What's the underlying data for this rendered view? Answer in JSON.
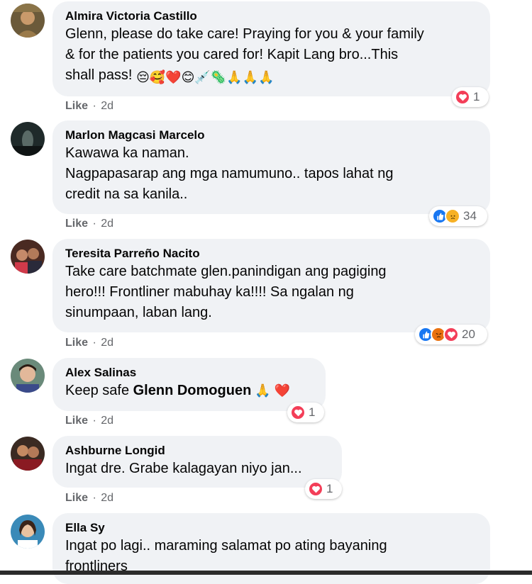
{
  "comments": [
    {
      "author": "Almira Victoria Castillo",
      "lines": [
        "Glenn, please do take care! Praying for you & your family",
        "& for the patients you cared for! Kapit Lang bro...This",
        "shall pass!"
      ],
      "emoji_line": "😔🥰❤️😊💉🦠🙏🙏🙏",
      "like_label": "Like",
      "time": "2d",
      "reaction_count": "1"
    },
    {
      "author": "Marlon Magcasi Marcelo",
      "lines": [
        "Kawawa ka naman.",
        "Nagpapasarap ang mga namumuno.. tapos lahat ng",
        "credit na sa kanila.."
      ],
      "like_label": "Like",
      "time": "2d",
      "reaction_count": "34"
    },
    {
      "author": "Teresita Parreño Nacito",
      "lines": [
        "Take care batchmate glen.panindigan ang pagiging",
        "hero!!! Frontliner mabuhay ka!!!! Sa ngalan ng",
        "sinumpaan, laban lang."
      ],
      "like_label": "Like",
      "time": "2d",
      "reaction_count": "20"
    },
    {
      "author": "Alex Salinas",
      "text_before": "Keep safe ",
      "mention": "Glenn Domoguen",
      "text_after": " 🙏 ❤️",
      "like_label": "Like",
      "time": "2d",
      "reaction_count": "1"
    },
    {
      "author": "Ashburne Longid",
      "lines": [
        "Ingat dre. Grabe kalagayan niyo jan..."
      ],
      "like_label": "Like",
      "time": "2d",
      "reaction_count": "1"
    },
    {
      "author": "Ella Sy",
      "lines": [
        "Ingat po lagi.. maraming salamat po ating bayaning",
        "frontliners"
      ]
    }
  ],
  "separator": "·",
  "colors": {
    "bubble": "#f0f2f5",
    "love": "#f33e58",
    "like": "#1877f2",
    "sad": "#f7b125",
    "angry": "#e9710f",
    "meta": "#65676b"
  },
  "icons": [
    "love-icon",
    "like-icon",
    "sad-icon",
    "angry-icon"
  ]
}
